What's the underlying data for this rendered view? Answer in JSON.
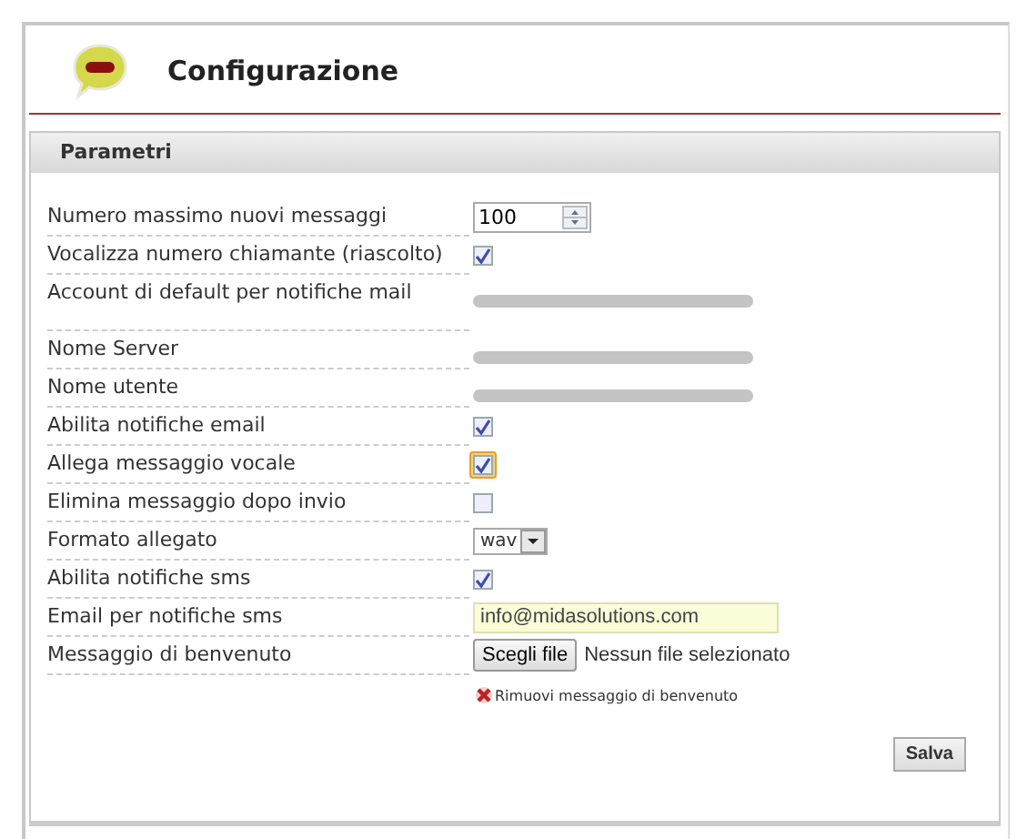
{
  "header": {
    "title": "Configurazione"
  },
  "panel": {
    "title": "Parametri"
  },
  "fields": [
    {
      "label": "Numero massimo nuovi messaggi",
      "kind": "number",
      "value": "100"
    },
    {
      "label": "Vocalizza numero chiamante (riascolto)",
      "kind": "checkbox",
      "checked": true,
      "focused": false
    },
    {
      "label": "Account di default per notifiche mail",
      "kind": "redacted"
    },
    {
      "label": "Nome Server",
      "kind": "redacted"
    },
    {
      "label": "Nome utente",
      "kind": "redacted"
    },
    {
      "label": "Abilita notifiche email",
      "kind": "checkbox",
      "checked": true,
      "focused": false
    },
    {
      "label": "Allega messaggio vocale",
      "kind": "checkbox",
      "checked": true,
      "focused": true
    },
    {
      "label": "Elimina messaggio dopo invio",
      "kind": "checkbox",
      "checked": false,
      "focused": false
    },
    {
      "label": "Formato allegato",
      "kind": "select",
      "value": "wav"
    },
    {
      "label": "Abilita notifiche sms",
      "kind": "checkbox",
      "checked": true,
      "focused": false
    },
    {
      "label": "Email per notifiche sms",
      "kind": "text",
      "value": "info@midasolutions.com"
    },
    {
      "label": "Messaggio di benvenuto",
      "kind": "file",
      "button": "Scegli file",
      "status": "Nessun file selezionato"
    }
  ],
  "remove_link": "Rimuovi messaggio di benvenuto",
  "save_button": "Salva"
}
